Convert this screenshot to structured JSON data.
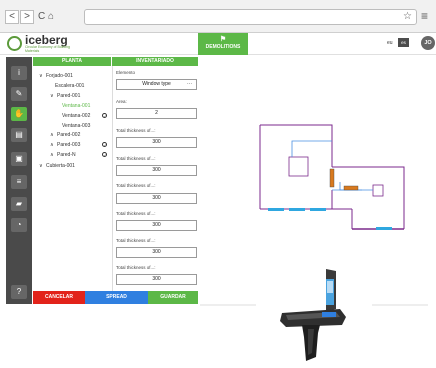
{
  "browser": {
    "back": "<",
    "forward": ">",
    "reload": "C",
    "home": "⌂",
    "url": "",
    "star": "☆",
    "menu": "≡"
  },
  "header": {
    "logo_text": "iceberg",
    "logo_sub": "Circular Economy of Building Materials",
    "demolitions_label": "DEMOLITIONS",
    "lang_label": "eu",
    "lang_value": "es",
    "avatar": "JO"
  },
  "sidebar": {
    "icons": [
      {
        "name": "info-icon",
        "glyph": "i"
      },
      {
        "name": "pencil-icon",
        "glyph": "✎"
      },
      {
        "name": "hand-icon",
        "glyph": "✋"
      },
      {
        "name": "document-icon",
        "glyph": "▤"
      },
      {
        "name": "image-icon",
        "glyph": "▣"
      },
      {
        "name": "list-icon",
        "glyph": "≡"
      },
      {
        "name": "truck-icon",
        "glyph": "▰"
      },
      {
        "name": "pie-chart-icon",
        "glyph": "◔"
      }
    ],
    "help": "?"
  },
  "columns": {
    "planta": "PLANTA",
    "inventariado": "INVENTARIADO"
  },
  "tree": [
    {
      "label": "Forjado-001",
      "chevron": "∨",
      "selected": false,
      "check": false
    },
    {
      "label": "Escalera-001",
      "chevron": "",
      "selected": false,
      "check": false
    },
    {
      "label": "Pared-001",
      "chevron": "∨",
      "selected": false,
      "check": false
    },
    {
      "label": "Ventana-001",
      "chevron": "",
      "selected": true,
      "check": false
    },
    {
      "label": "Ventana-002",
      "chevron": "",
      "selected": false,
      "check": true
    },
    {
      "label": "Ventana-003",
      "chevron": "",
      "selected": false,
      "check": false
    },
    {
      "label": "Pared-002",
      "chevron": "∧",
      "selected": false,
      "check": false
    },
    {
      "label": "Pared-003",
      "chevron": "∧",
      "selected": false,
      "check": true
    },
    {
      "label": "Pared-N",
      "chevron": "∧",
      "selected": false,
      "check": true
    },
    {
      "label": "Cubierta-001",
      "chevron": "∨",
      "selected": false,
      "check": false
    }
  ],
  "form": {
    "elemento_label": "Elemento",
    "elemento_value": "Window type",
    "elemento_more": "···",
    "area_label": "Area:",
    "area_value": "2",
    "thickness_fields": [
      {
        "label": "Total thickness of...:",
        "value": "300"
      },
      {
        "label": "Total thickness of...:",
        "value": "300"
      },
      {
        "label": "Total thickness of...:",
        "value": "300"
      },
      {
        "label": "Total thickness of...:",
        "value": "300"
      },
      {
        "label": "Total thickness of...:",
        "value": "300"
      },
      {
        "label": "Total thickness of...:",
        "value": "300"
      }
    ]
  },
  "footer": {
    "cancel": "CANCELAR",
    "spread": "SPREAD",
    "save": "GUARDAR"
  },
  "colors": {
    "green": "#5cb847",
    "blue_button": "#2f7fe0",
    "red_button": "#e2231a",
    "sidebar": "#4a4a4a",
    "wall": "#7b2a8c",
    "blue_line": "#4a90e2",
    "window": "#2fa7e0",
    "door": "#d97a1f"
  }
}
